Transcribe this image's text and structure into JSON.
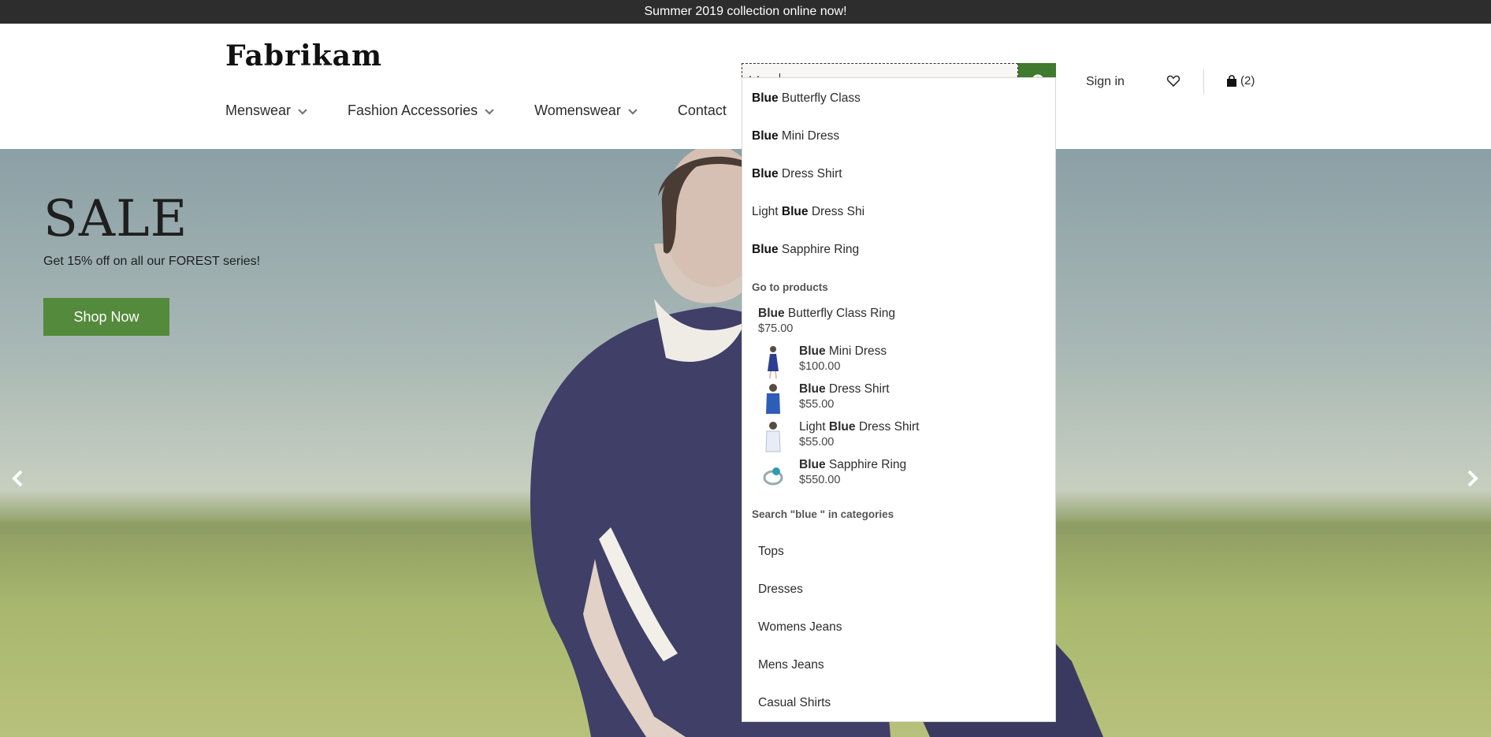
{
  "promo": {
    "text": "Summer 2019 collection online now!"
  },
  "header": {
    "logo": "Fabrikam",
    "nav": [
      "Menswear",
      "Fashion Accessories",
      "Womenswear",
      "Contact"
    ],
    "search_value": "blue",
    "sign_in": "Sign in",
    "cart_count": "(2)"
  },
  "hero": {
    "title": "SALE",
    "subtitle": "Get 15% off on all our FOREST series!",
    "cta": "Shop Now"
  },
  "dropdown": {
    "suggestions": [
      {
        "pre": "",
        "bold": "Blue",
        "post": " Butterfly Class"
      },
      {
        "pre": "",
        "bold": "Blue",
        "post": " Mini Dress"
      },
      {
        "pre": "",
        "bold": "Blue",
        "post": " Dress Shirt"
      },
      {
        "pre": "Light ",
        "bold": "Blue",
        "post": " Dress Shi"
      },
      {
        "pre": "",
        "bold": "Blue",
        "post": " Sapphire Ring"
      }
    ],
    "products_title": "Go to products",
    "products": [
      {
        "pre": "",
        "bold": "Blue",
        "post": " Butterfly Class Ring",
        "price": "$75.00",
        "thumb": ""
      },
      {
        "pre": "",
        "bold": "Blue",
        "post": " Mini Dress",
        "price": "$100.00",
        "thumb": "dress"
      },
      {
        "pre": "",
        "bold": "Blue",
        "post": " Dress Shirt",
        "price": "$55.00",
        "thumb": "shirt"
      },
      {
        "pre": "Light ",
        "bold": "Blue",
        "post": " Dress Shirt",
        "price": "$55.00",
        "thumb": "light-shirt"
      },
      {
        "pre": "",
        "bold": "Blue",
        "post": " Sapphire Ring",
        "price": "$550.00",
        "thumb": "ring"
      }
    ],
    "categories_title": "Search \"blue \" in categories",
    "categories": [
      "Tops",
      "Dresses",
      "Womens Jeans",
      "Mens Jeans",
      "Casual Shirts"
    ]
  },
  "colors": {
    "promo_bg": "#2d2d2d",
    "search_button": "#3f7a2f",
    "cta_button": "#548a3b"
  }
}
